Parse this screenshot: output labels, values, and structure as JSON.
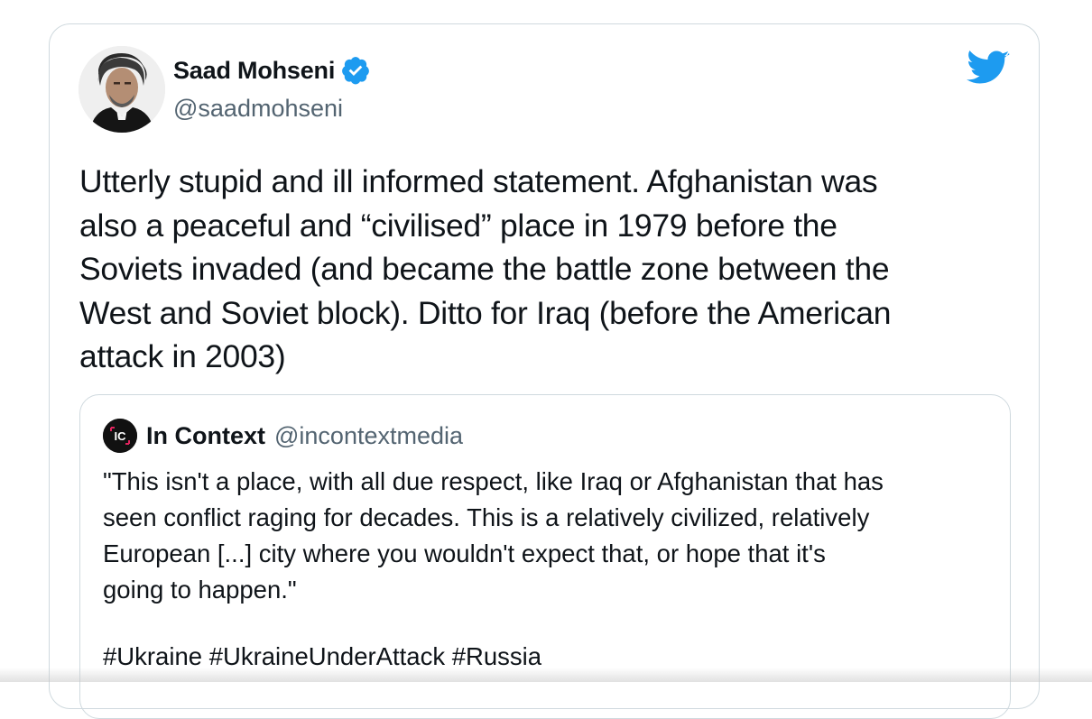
{
  "author": {
    "name": "Saad Mohseni",
    "handle": "@saadmohseni",
    "verified": true,
    "avatar_icon": "person-portrait-avatar"
  },
  "brand": {
    "icon": "twitter-bird-icon",
    "color": "#1d9bf0"
  },
  "tweet": {
    "text": "Utterly stupid and ill informed statement. Afghanistan was\nalso a peaceful and “civilised” place in 1979 before the\nSoviets invaded (and became the battle zone between the\nWest and Soviet block). Ditto for Iraq (before the American\nattack in 2003)"
  },
  "quoted_tweet": {
    "avatar_letters": "IC",
    "name": "In Context",
    "handle": "@incontextmedia",
    "text": "\"This isn't a place, with all due respect, like Iraq or Afghanistan that has\nseen conflict raging for decades. This is a relatively civilized, relatively\nEuropean [...] city where you wouldn't expect that, or hope that it's\ngoing to happen.\"",
    "hashtags": "#Ukraine #UkraineUnderAttack #Russia"
  },
  "colors": {
    "text": "#0f1419",
    "secondary": "#536471",
    "border": "#cfd9de",
    "verified": "#1d9bf0",
    "quote_avatar_accent": "#e0245e"
  }
}
